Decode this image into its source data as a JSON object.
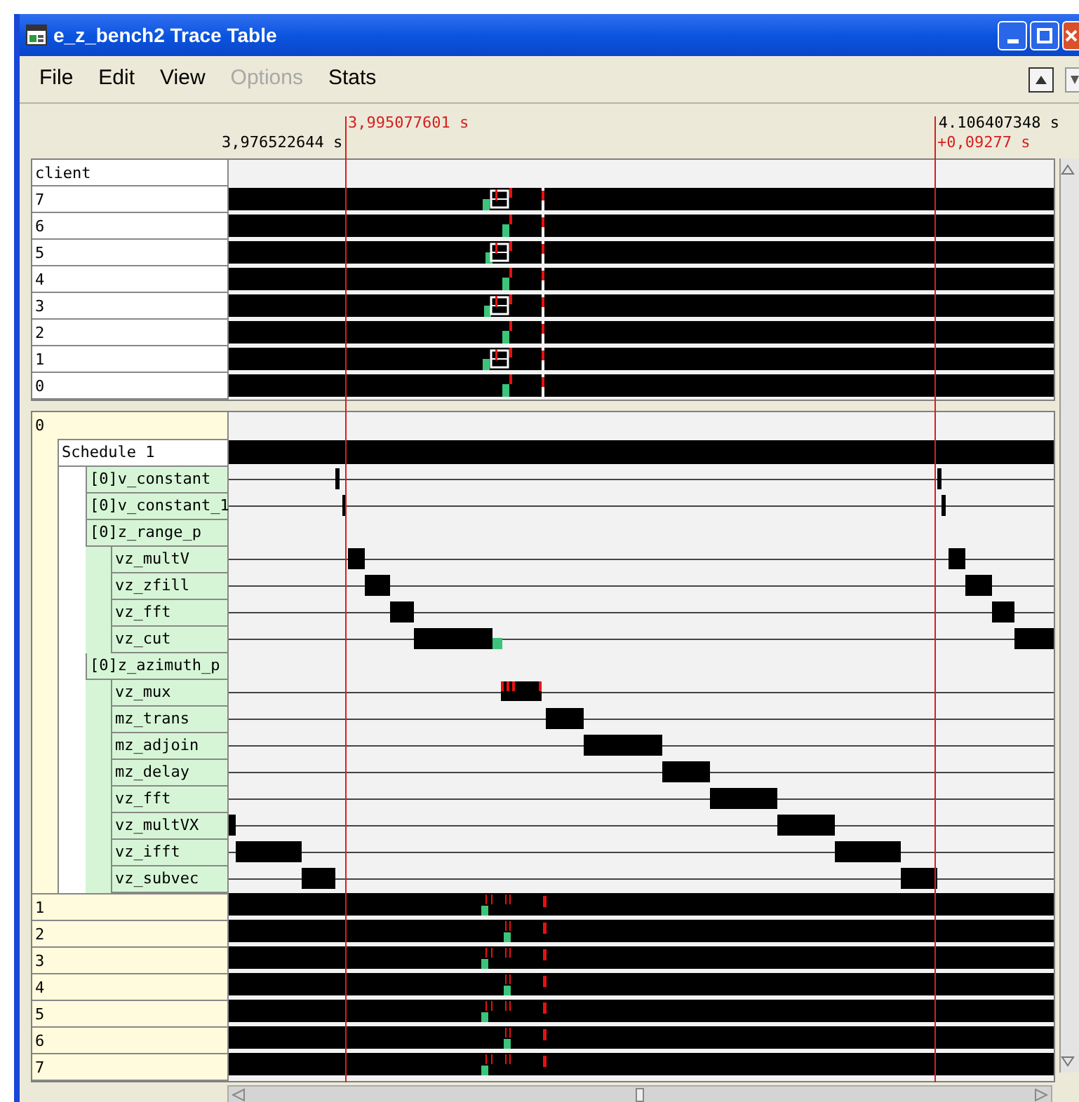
{
  "window": {
    "title": "e_z_bench2 Trace Table"
  },
  "menu": [
    {
      "label": "File",
      "disabled": false
    },
    {
      "label": "Edit",
      "disabled": false
    },
    {
      "label": "View",
      "disabled": false
    },
    {
      "label": "Options",
      "disabled": true
    },
    {
      "label": "Stats",
      "disabled": false
    }
  ],
  "time_header": {
    "start": "3,976522644 s",
    "cursor": "3,995077601 s",
    "end": "4.106407348 s",
    "delta": "+0,09277 s"
  },
  "client_panel": {
    "header": "client",
    "rows": [
      "7",
      "6",
      "5",
      "4",
      "3",
      "2",
      "1",
      "0"
    ]
  },
  "schedule_panel": {
    "root": "0",
    "schedule": "Schedule 1",
    "tasks": [
      {
        "label": "[0]v_constant"
      },
      {
        "label": "[0]v_constant_1"
      },
      {
        "label": "[0]z_range_p",
        "children": [
          {
            "label": "vz_multV"
          },
          {
            "label": "vz_zfill"
          },
          {
            "label": "vz_fft"
          },
          {
            "label": "vz_cut"
          }
        ]
      },
      {
        "label": "[0]z_azimuth_p",
        "children": [
          {
            "label": "vz_mux"
          },
          {
            "label": "mz_trans"
          },
          {
            "label": "mz_adjoin"
          },
          {
            "label": "mz_delay"
          },
          {
            "label": "vz_fft"
          },
          {
            "label": "vz_multVX"
          },
          {
            "label": "vz_ifft"
          },
          {
            "label": "vz_subvec"
          }
        ]
      }
    ],
    "process_rows": [
      "1",
      "2",
      "3",
      "4",
      "5",
      "6",
      "7"
    ]
  }
}
